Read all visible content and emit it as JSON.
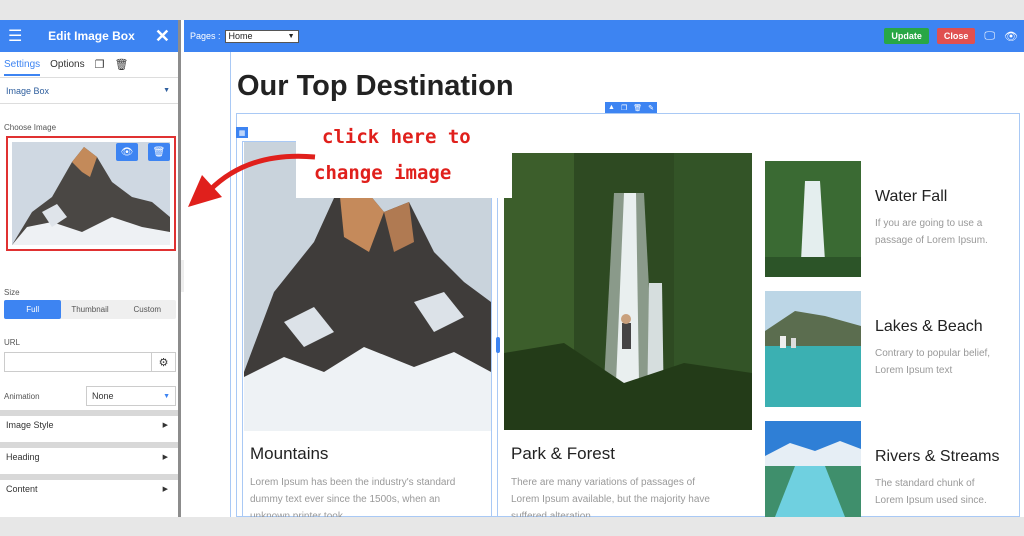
{
  "sidebar": {
    "title": "Edit Image Box",
    "tabs": [
      "Settings",
      "Options"
    ],
    "section_image_box": "Image Box",
    "choose_image_label": "Choose Image",
    "size_label": "Size",
    "size_options": [
      "Full",
      "Thumbnail",
      "Custom"
    ],
    "size_selected": "Full",
    "url_label": "URL",
    "url_value": "",
    "animation_label": "Animation",
    "animation_value": "None",
    "accordions": [
      "Image Style",
      "Heading",
      "Content"
    ]
  },
  "topbar": {
    "pages_label": "Pages :",
    "pages_value": "Home",
    "update_label": "Update",
    "close_label": "Close"
  },
  "canvas": {
    "heading": "Our Top Destination",
    "callout_line1": "click here to",
    "callout_line2": "change image",
    "cards": [
      {
        "title": "Mountains",
        "lines": [
          "Lorem Ipsum has been the industry's standard",
          "dummy text ever since the 1500s, when an",
          "unknown printer took ."
        ]
      },
      {
        "title": "Park & Forest",
        "lines": [
          "There are many variations of passages of",
          "Lorem Ipsum available, but the majority have",
          "suffered alteration."
        ]
      }
    ],
    "side_items": [
      {
        "title": "Water Fall",
        "lines": [
          "If you are going to use a",
          "passage of Lorem Ipsum."
        ]
      },
      {
        "title": "Lakes & Beach",
        "lines": [
          "Contrary to popular belief,",
          "Lorem Ipsum text"
        ]
      },
      {
        "title": "Rivers & Streams",
        "lines": [
          "The standard chunk of",
          "Lorem Ipsum used since."
        ]
      }
    ]
  },
  "colors": {
    "accent": "#3d84f2",
    "update": "#28a745",
    "close": "#e05050",
    "callout": "#e0201c"
  }
}
